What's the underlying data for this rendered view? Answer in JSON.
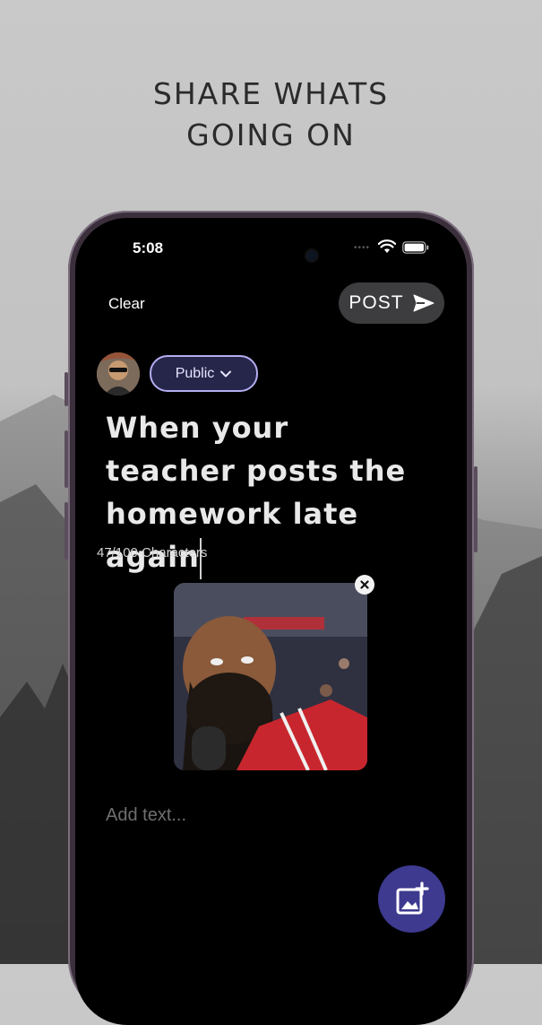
{
  "promo": {
    "headline_line1": "SHARE WHATS",
    "headline_line2": "GOING ON"
  },
  "status_bar": {
    "time": "5:08"
  },
  "toolbar": {
    "clear_label": "Clear",
    "post_label": "POST"
  },
  "composer": {
    "visibility": "Public",
    "post_text": "When your teacher posts the homework late again",
    "char_count": "47/100 Characters",
    "add_text_placeholder": "Add text..."
  },
  "icons": {
    "send": "send-icon",
    "chevron": "chevron-down-icon",
    "remove": "close-icon",
    "add_media": "add-photo-icon",
    "wifi": "wifi-icon",
    "battery": "battery-icon"
  },
  "colors": {
    "accent": "#3d3a8f",
    "visibility_border": "#b4adf2",
    "post_button_bg": "#3d3d3f"
  }
}
